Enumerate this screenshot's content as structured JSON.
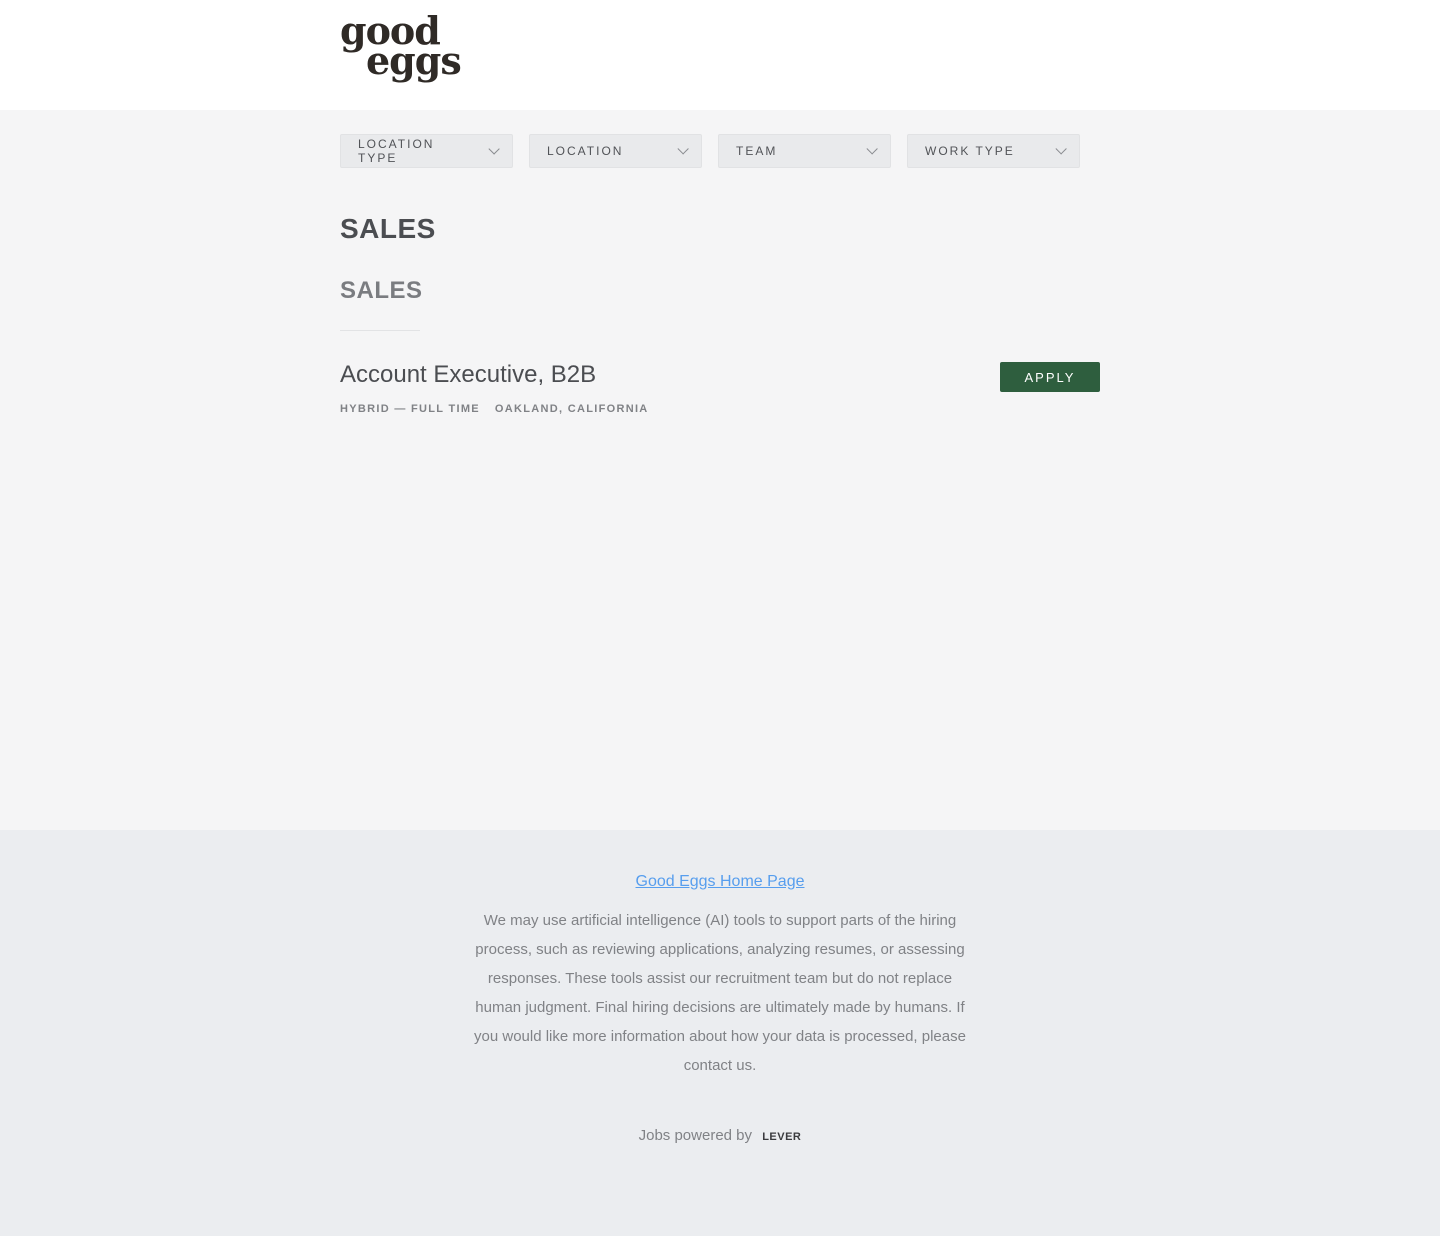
{
  "header": {
    "logo_line1": "good",
    "logo_line2": "eggs"
  },
  "filters": [
    {
      "label": "LOCATION TYPE"
    },
    {
      "label": "LOCATION"
    },
    {
      "label": "TEAM"
    },
    {
      "label": "WORK TYPE"
    }
  ],
  "department": "SALES",
  "team": "SALES",
  "posting": {
    "title": "Account Executive, B2B",
    "work_type": "HYBRID — FULL TIME",
    "location": "OAKLAND, CALIFORNIA",
    "apply_label": "APPLY"
  },
  "footer": {
    "home_link": "Good Eggs Home Page",
    "ai_notice": "We may use artificial intelligence (AI) tools to support parts of the hiring process, such as reviewing applications, analyzing resumes, or assessing responses. These tools assist our recruitment team but do not replace human judgment. Final hiring decisions are ultimately made by humans. If you would like more information about how your data is processed, please contact us.",
    "powered_by": "Jobs powered by",
    "powered_brand": "LEVER"
  },
  "colors": {
    "apply_button": "#2e5e3e",
    "link": "#579eee",
    "page_bg": "#f5f5f6",
    "footer_bg": "#ebedf0"
  }
}
